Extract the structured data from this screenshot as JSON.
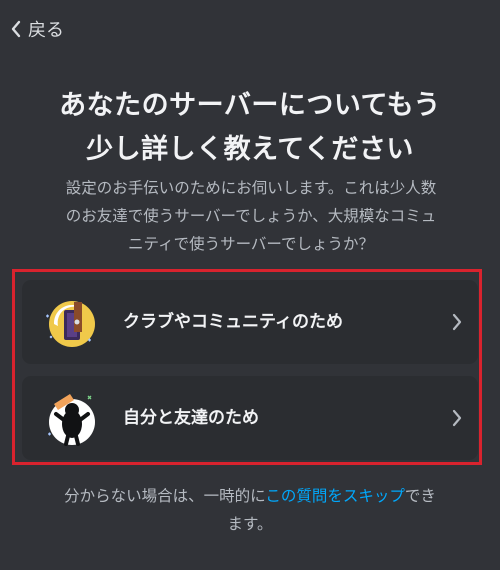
{
  "nav": {
    "back_label": "戻る"
  },
  "header": {
    "title_line1": "あなたのサーバーについてもう",
    "title_line2": "少し詳しく教えてください",
    "subtitle_line1": "設定のお手伝いのためにお伺いします。これは少人数",
    "subtitle_line2": "のお友達で使うサーバーでしょうか、大規模なコミュ",
    "subtitle_line3": "ニティで使うサーバーでしょうか？"
  },
  "options": [
    {
      "label": "クラブやコミュニティのため",
      "icon": "club-community-icon"
    },
    {
      "label": "自分と友達のため",
      "icon": "friends-icon"
    }
  ],
  "footer": {
    "prefix": "分からない場合は、一時的に",
    "skip_link": "この質問をスキップ",
    "suffix_line1": "でき",
    "suffix_line2": "ます。"
  },
  "colors": {
    "background": "#313338",
    "card": "#2b2d31",
    "link": "#00a8fc",
    "highlight_border": "#d9232e"
  }
}
